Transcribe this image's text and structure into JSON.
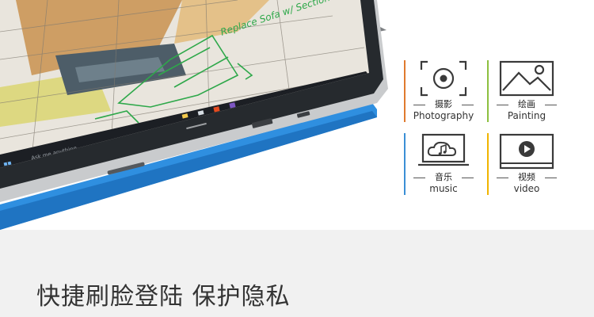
{
  "hero": {
    "sketch_note": "Replace Sofa w/ Sectional",
    "taskbar_search": "Ask me anything"
  },
  "features": [
    {
      "cn": "摄影",
      "en": "Photography",
      "icon": "camera-icon",
      "accent": "#e07a2e"
    },
    {
      "cn": "绘画",
      "en": "Painting",
      "icon": "landscape-picture-icon",
      "accent": "#8cbf3f"
    },
    {
      "cn": "音乐",
      "en": "music",
      "icon": "music-cloud-icon",
      "accent": "#3a8fd6"
    },
    {
      "cn": "视频",
      "en": "video",
      "icon": "play-video-icon",
      "accent": "#f0b400"
    }
  ],
  "privacy": {
    "title": "快捷刷脸登陆 保护隐私"
  },
  "colors": {
    "keyboard_cover": "#2f8fe0",
    "device_frame": "#c9cbcd",
    "bottom_bg": "#f1f1f1",
    "sketch_green": "#2ea84a"
  }
}
